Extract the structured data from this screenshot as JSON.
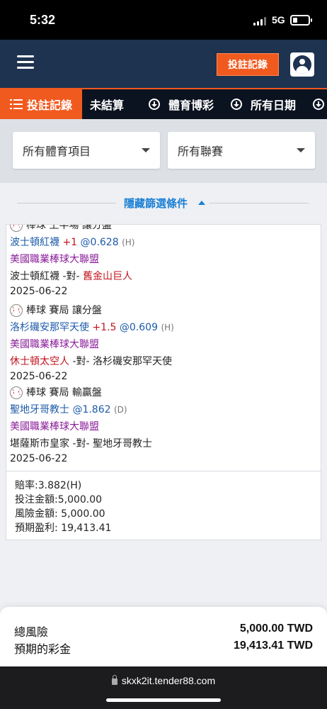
{
  "status_bar": {
    "time": "5:32",
    "network": "5G"
  },
  "topnav": {
    "bet_history_button": "投註記錄"
  },
  "tabs": [
    {
      "label": "投註記錄"
    },
    {
      "label": "未結算"
    },
    {
      "label": "體育博彩"
    },
    {
      "label": "所有日期"
    }
  ],
  "filters": {
    "sport_select": "所有體育項目",
    "league_select": "所有聯賽",
    "hide_filter": "隱藏篩選條件"
  },
  "bet": {
    "legs": [
      {
        "market": "棒球 上半場 讓分盤",
        "selection": "波士頓紅襪",
        "handicap": "+1",
        "odds": "@0.628",
        "side": "(H)",
        "league": "美國職業棒球大聯盟",
        "home": "波士頓紅襪",
        "vs": "-對-",
        "away": "舊金山巨人",
        "date": "2025-06-22"
      },
      {
        "market": "棒球 賽局 讓分盤",
        "selection": "洛杉磯安那罕天使",
        "handicap": "+1.5",
        "odds": "@0.609",
        "side": "(H)",
        "league": "美國職業棒球大聯盟",
        "home": "休士頓太空人",
        "vs": "-對-",
        "away": "洛杉磯安那罕天使",
        "date": "2025-06-22"
      },
      {
        "market": "棒球 賽局 輸贏盤",
        "selection": "聖地牙哥教士",
        "handicap": "",
        "odds": "@1.862",
        "side": "(D)",
        "league": "美國職業棒球大聯盟",
        "home": "堪薩斯市皇家",
        "vs": "-對-",
        "away": "聖地牙哥教士",
        "date": "2025-06-22"
      }
    ],
    "odds_total": "賠率:3.882(H)",
    "stake": "投注金額:5,000.00",
    "risk": "風險金額: 5,000.00",
    "expected_profit": "預期盈利: 19,413.41"
  },
  "totals": {
    "risk_label": "總風險",
    "risk_value": "5,000.00 TWD",
    "payout_label": "預期的彩金",
    "payout_value": "19,413.41 TWD"
  },
  "browser": {
    "url": "skxk2it.tender88.com"
  },
  "colors": {
    "accent": "#f15a1f",
    "nav": "#1e3350",
    "link": "#1a7fd4"
  }
}
